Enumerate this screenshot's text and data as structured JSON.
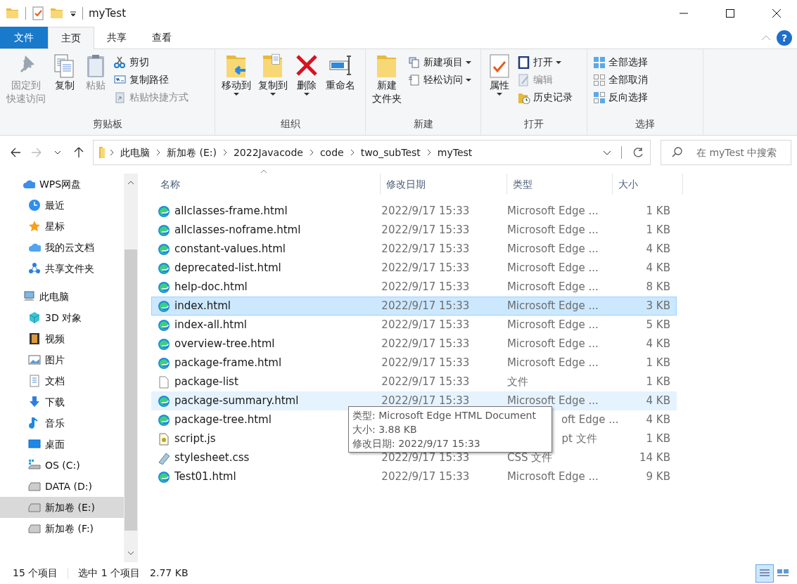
{
  "window": {
    "title": "myTest"
  },
  "ribbon_tabs": [
    {
      "label": "文件",
      "kind": "file",
      "selected": false
    },
    {
      "label": "主页",
      "kind": "tab",
      "selected": true
    },
    {
      "label": "共享",
      "kind": "tab",
      "selected": false
    },
    {
      "label": "查看",
      "kind": "tab",
      "selected": false
    }
  ],
  "ribbon_groups": [
    {
      "label": "剪贴板",
      "buttons": [
        {
          "lines": [
            "固定到",
            "快速访问"
          ],
          "kind": "large",
          "disabled": true,
          "dropdown": false
        },
        {
          "label": "复制",
          "kind": "large",
          "disabled": false,
          "dropdown": false
        },
        {
          "label": "粘贴",
          "kind": "large",
          "disabled": true,
          "dropdown": false
        },
        {
          "label": "剪切",
          "kind": "small",
          "disabled": false,
          "dropdown": false
        },
        {
          "label": "复制路径",
          "kind": "small",
          "disabled": false,
          "dropdown": false
        },
        {
          "label": "粘贴快捷方式",
          "kind": "small",
          "disabled": true,
          "dropdown": false
        }
      ]
    },
    {
      "label": "组织",
      "buttons": [
        {
          "label": "移动到",
          "kind": "large",
          "disabled": false,
          "dropdown": true
        },
        {
          "label": "复制到",
          "kind": "large",
          "disabled": false,
          "dropdown": true
        },
        {
          "label": "删除",
          "kind": "large",
          "disabled": false,
          "dropdown": true
        },
        {
          "label": "重命名",
          "kind": "large",
          "disabled": false,
          "dropdown": false
        }
      ]
    },
    {
      "label": "新建",
      "buttons": [
        {
          "lines": [
            "新建",
            "文件夹"
          ],
          "kind": "large",
          "disabled": false,
          "dropdown": false
        },
        {
          "label": "新建项目",
          "kind": "small",
          "disabled": false,
          "dropdown": true
        },
        {
          "label": "轻松访问",
          "kind": "small",
          "disabled": false,
          "dropdown": true
        }
      ]
    },
    {
      "label": "打开",
      "buttons": [
        {
          "label": "属性",
          "kind": "large",
          "disabled": false,
          "dropdown": true
        },
        {
          "label": "打开",
          "kind": "small",
          "disabled": false,
          "dropdown": true
        },
        {
          "label": "编辑",
          "kind": "small",
          "disabled": true,
          "dropdown": false
        },
        {
          "label": "历史记录",
          "kind": "small",
          "disabled": false,
          "dropdown": false
        }
      ]
    },
    {
      "label": "选择",
      "buttons": [
        {
          "label": "全部选择",
          "kind": "small",
          "disabled": false,
          "dropdown": false
        },
        {
          "label": "全部取消",
          "kind": "small",
          "disabled": false,
          "dropdown": false
        },
        {
          "label": "反向选择",
          "kind": "small",
          "disabled": false,
          "dropdown": false
        }
      ]
    }
  ],
  "help_button": {
    "label": "?"
  },
  "address": {
    "path": [
      "此电脑",
      "新加卷 (E:)",
      "2022Javacode",
      "code",
      "two_subTest",
      "myTest"
    ],
    "forward_disabled": true
  },
  "search": {
    "placeholder": "在 myTest 中搜索"
  },
  "sidebar": {
    "items": [
      {
        "label": "WPS网盘",
        "selected": false,
        "children": [
          {
            "label": "最近",
            "selected": false
          },
          {
            "label": "星标",
            "selected": false
          },
          {
            "label": "我的云文档",
            "selected": false
          },
          {
            "label": "共享文件夹",
            "selected": false
          }
        ]
      },
      {
        "label": "此电脑",
        "selected": false,
        "children": [
          {
            "label": "3D 对象",
            "selected": false
          },
          {
            "label": "视频",
            "selected": false
          },
          {
            "label": "图片",
            "selected": false
          },
          {
            "label": "文档",
            "selected": false
          },
          {
            "label": "下载",
            "selected": false
          },
          {
            "label": "音乐",
            "selected": false
          },
          {
            "label": "桌面",
            "selected": false
          },
          {
            "label": "OS (C:)",
            "selected": false
          },
          {
            "label": "DATA (D:)",
            "selected": false
          },
          {
            "label": "新加卷 (E:)",
            "selected": true
          },
          {
            "label": "新加卷 (F:)",
            "selected": false
          }
        ]
      }
    ]
  },
  "table": {
    "columns": [
      "名称",
      "修改日期",
      "类型",
      "大小"
    ],
    "rows": [
      {
        "kind": "edge",
        "name": "allclasses-frame.html",
        "date": "2022/9/17 15:33",
        "type": "Microsoft Edge ...",
        "size": "1 KB",
        "selected": false,
        "hovered": false,
        "covered": false
      },
      {
        "kind": "edge",
        "name": "allclasses-noframe.html",
        "date": "2022/9/17 15:33",
        "type": "Microsoft Edge ...",
        "size": "1 KB",
        "selected": false,
        "hovered": false,
        "covered": false
      },
      {
        "kind": "edge",
        "name": "constant-values.html",
        "date": "2022/9/17 15:33",
        "type": "Microsoft Edge ...",
        "size": "4 KB",
        "selected": false,
        "hovered": false,
        "covered": false
      },
      {
        "kind": "edge",
        "name": "deprecated-list.html",
        "date": "2022/9/17 15:33",
        "type": "Microsoft Edge ...",
        "size": "4 KB",
        "selected": false,
        "hovered": false,
        "covered": false
      },
      {
        "kind": "edge",
        "name": "help-doc.html",
        "date": "2022/9/17 15:33",
        "type": "Microsoft Edge ...",
        "size": "8 KB",
        "selected": false,
        "hovered": false,
        "covered": false
      },
      {
        "kind": "edge",
        "name": "index.html",
        "date": "2022/9/17 15:33",
        "type": "Microsoft Edge ...",
        "size": "3 KB",
        "selected": true,
        "hovered": false,
        "covered": false
      },
      {
        "kind": "edge",
        "name": "index-all.html",
        "date": "2022/9/17 15:33",
        "type": "Microsoft Edge ...",
        "size": "5 KB",
        "selected": false,
        "hovered": false,
        "covered": false
      },
      {
        "kind": "edge",
        "name": "overview-tree.html",
        "date": "2022/9/17 15:33",
        "type": "Microsoft Edge ...",
        "size": "4 KB",
        "selected": false,
        "hovered": false,
        "covered": false
      },
      {
        "kind": "edge",
        "name": "package-frame.html",
        "date": "2022/9/17 15:33",
        "type": "Microsoft Edge ...",
        "size": "1 KB",
        "selected": false,
        "hovered": false,
        "covered": false
      },
      {
        "kind": "file",
        "name": "package-list",
        "date": "2022/9/17 15:33",
        "type": "文件",
        "size": "1 KB",
        "selected": false,
        "hovered": false,
        "covered": false
      },
      {
        "kind": "edge",
        "name": "package-summary.html",
        "date": "2022/9/17 15:33",
        "type": "Microsoft Edge ...",
        "size": "4 KB",
        "selected": false,
        "hovered": true,
        "covered": false
      },
      {
        "kind": "edge",
        "name": "package-tree.html",
        "type": "oft Edge ...",
        "size": "4 KB",
        "selected": false,
        "hovered": false,
        "covered": true
      },
      {
        "kind": "script",
        "name": "script.js",
        "type": "pt 文件",
        "size": "1 KB",
        "selected": false,
        "hovered": false,
        "covered": true
      },
      {
        "kind": "css",
        "name": "stylesheet.css",
        "date": "2022/9/17 15:33",
        "type": "CSS 文件",
        "size": "14 KB",
        "selected": false,
        "hovered": false,
        "covered": false
      },
      {
        "kind": "edge",
        "name": "Test01.html",
        "date": "2022/9/17 15:33",
        "type": "Microsoft Edge ...",
        "size": "9 KB",
        "selected": false,
        "hovered": false,
        "covered": false
      }
    ]
  },
  "tooltip": {
    "lines": [
      "类型: Microsoft Edge HTML Document",
      "大小: 3.88 KB",
      "修改日期: 2022/9/17 15:33"
    ]
  },
  "status_bar": {
    "item_count": "15 个项目",
    "selection": "选中 1 个项目",
    "selection_size": "2.77 KB",
    "view_buttons": [
      {
        "selected": true
      },
      {
        "selected": false
      }
    ]
  }
}
